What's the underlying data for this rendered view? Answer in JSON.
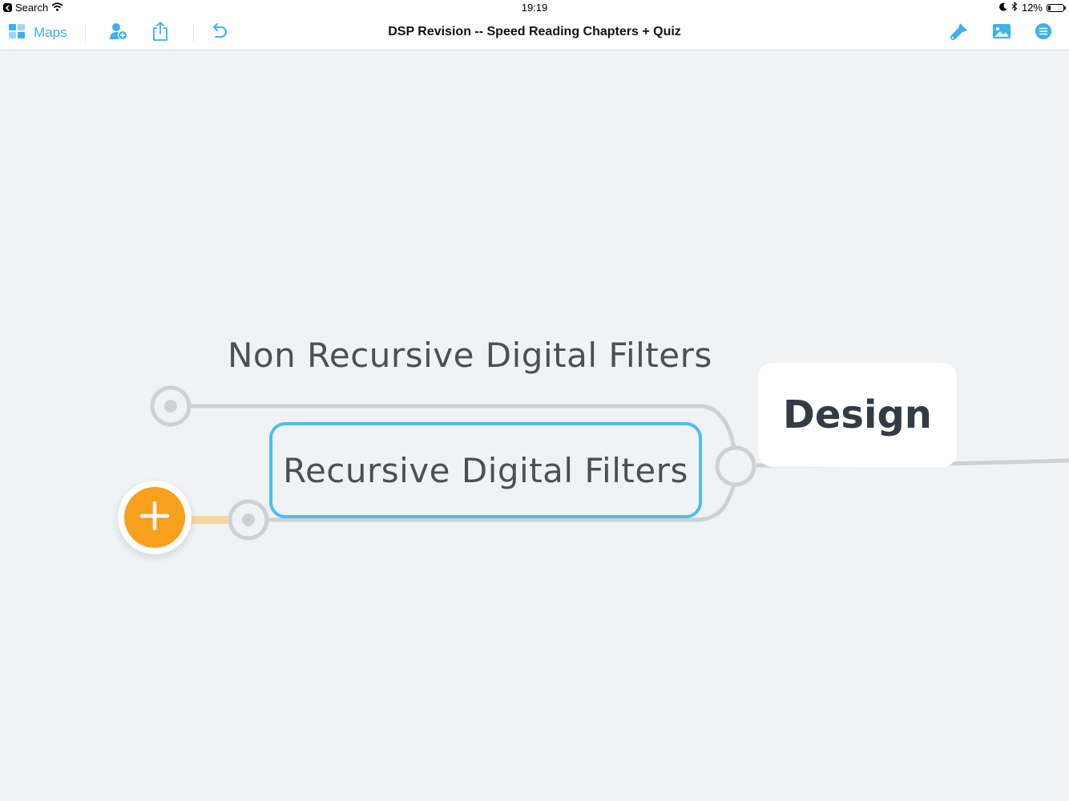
{
  "status_bar": {
    "back_app": "Search",
    "time": "19:19",
    "battery_percent": "12%",
    "icons": [
      "wifi-icon",
      "moon-icon",
      "bluetooth-icon",
      "battery-icon"
    ]
  },
  "toolbar": {
    "maps_label": "Maps",
    "document_title": "DSP Revision -- Speed Reading Chapters + Quiz",
    "left_icons": [
      "grid-icon",
      "add-person-icon",
      "share-icon",
      "undo-icon"
    ],
    "right_icons": [
      "style-brush-icon",
      "insert-image-icon",
      "outline-menu-icon"
    ],
    "accent_color": "#3eb0ee"
  },
  "mind_map": {
    "central_topic": "Design",
    "topics": [
      {
        "label": "Non Recursive Digital Filters",
        "selected": false
      },
      {
        "label": "Recursive Digital Filters",
        "selected": true
      }
    ],
    "selection_color": "#4dbdf4",
    "add_button_color": "#f7a01d"
  }
}
